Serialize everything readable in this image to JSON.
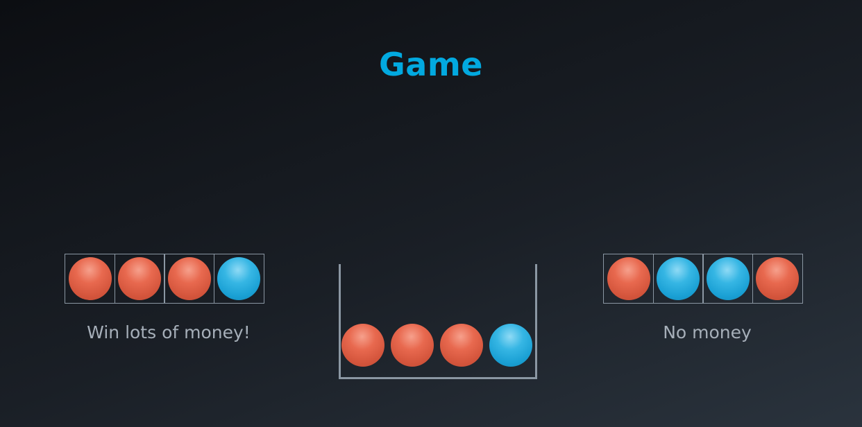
{
  "title": "Game",
  "left_option": {
    "balls": [
      "red",
      "red",
      "red",
      "blue"
    ],
    "caption": "Win lots of money!"
  },
  "cup": {
    "balls": [
      "red",
      "red",
      "red",
      "blue"
    ]
  },
  "right_option": {
    "balls": [
      "red",
      "blue",
      "blue",
      "red"
    ],
    "caption": "No money"
  },
  "colors": {
    "title": "#02a9e0",
    "red_ball": "#e0604a",
    "blue_ball": "#22a9dc",
    "outline": "#8b97a3",
    "caption": "#a6afb9"
  }
}
